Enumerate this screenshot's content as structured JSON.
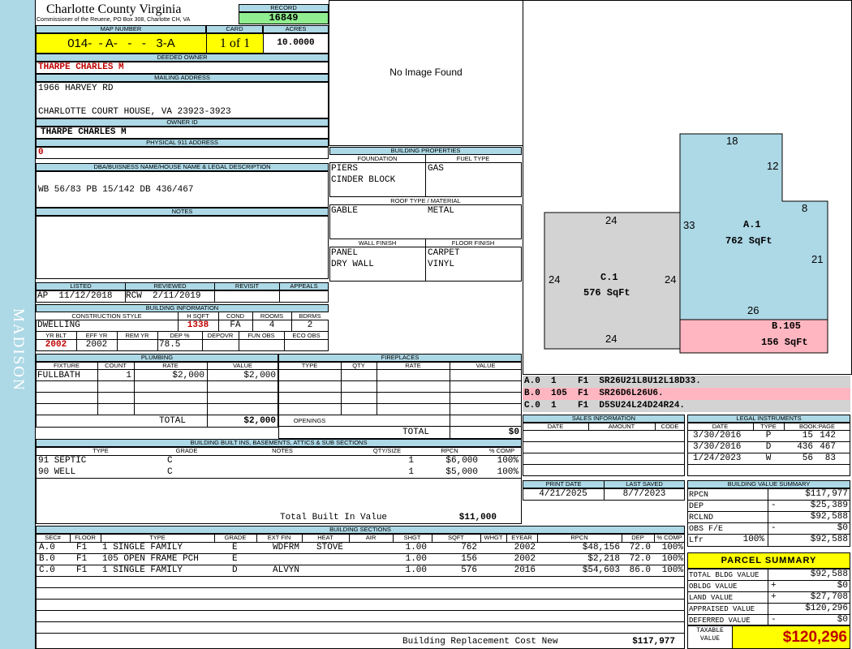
{
  "side_label": "MADISON",
  "county": {
    "title": "Charlotte County Virginia",
    "subtitle": "Commissioner of the Reuene, PO Box 308, Charlotte CH, VA"
  },
  "record": {
    "label": "RECORD",
    "value": "16849"
  },
  "map": {
    "label": "MAP NUMBER",
    "value": "014-  - A-   -   -   3-A"
  },
  "card": {
    "label": "CARD",
    "value": "1 of 1"
  },
  "acres": {
    "label": "ACRES",
    "value": "10.0000"
  },
  "owner": {
    "deeded_label": "DEEDED OWNER",
    "deeded": "THARPE CHARLES M",
    "mailing_label": "MAILING ADDRESS",
    "addr1": "1966 HARVEY RD",
    "addr2": "CHARLOTTE COURT HOUSE, VA 23923-3923",
    "id_label": "OWNER ID",
    "id_name": "THARPE CHARLES M",
    "p911_label": "PHYSICAL 911 ADDRESS",
    "p911": "0"
  },
  "dba": {
    "label": "DBA/BUISNESS NAME/HOUSE NAME & LEGAL DESCRIPTION",
    "value": "WB 56/83 PB 15/142 DB 436/467"
  },
  "notes": {
    "label": "NOTES"
  },
  "image": {
    "text": "No Image Found"
  },
  "building_props": {
    "label": "BUILDING PROPERTIES",
    "foundation_label": "FOUNDATION",
    "foundation": [
      "PIERS",
      "CINDER BLOCK"
    ],
    "fuel_label": "FUEL TYPE",
    "fuel": "GAS",
    "roof_label": "ROOF TYPE / MATERIAL",
    "roof_type": "GABLE",
    "roof_mat": "METAL",
    "wall_label": "WALL FINISH",
    "wall": [
      "PANEL",
      "DRY WALL"
    ],
    "floor_label": "FLOOR FINISH",
    "floor": [
      "CARPET",
      "VINYL"
    ]
  },
  "listing": {
    "listed_label": "LISTED",
    "listed": "AP  11/12/2018",
    "reviewed_label": "REVIEWED",
    "reviewed": "RCW  2/11/2019",
    "revisit_label": "REVISIT",
    "appeals_label": "APPEALS"
  },
  "building_info": {
    "label": "BUILDING INFORMATION",
    "style_label": "CONSTRUCTION STYLE",
    "style": "DWELLING",
    "hsqft_label": "H SQFT",
    "hsqft": "1338",
    "cond_label": "COND",
    "cond": "FA",
    "rooms_label": "ROOMS",
    "rooms": "4",
    "bdrms_label": "BDRMS",
    "bdrms": "2",
    "yrblt_label": "YR BLT",
    "yrblt": "2002",
    "effyr_label": "EFF YR",
    "effyr": "2002",
    "remyr_label": "REM YR",
    "dep_label": "DEP %",
    "dep": "78.5",
    "depovr_label": "DEPOVR",
    "funobs_label": "FUN OBS",
    "ecoobs_label": "ECO OBS"
  },
  "plumbing": {
    "label": "PLUMBING",
    "cols": [
      "FIXTURE",
      "COUNT",
      "RATE",
      "VALUE"
    ],
    "row": {
      "fixture": "FULLBATH",
      "count": "1",
      "rate": "$2,000",
      "value": "$2,000"
    },
    "total_label": "TOTAL",
    "total": "$2,000"
  },
  "fireplaces": {
    "label": "FIREPLACES",
    "cols": [
      "TYPE",
      "QTY",
      "RATE",
      "VALUE"
    ],
    "openings_label": "OPENINGS",
    "total_label": "TOTAL",
    "total": "$0"
  },
  "builtins": {
    "label": "BUILDING BUILT INS, BASEMENTS, ATTICS & SUB SECTIONS",
    "cols": [
      "TYPE",
      "GRADE",
      "NOTES",
      "QTY/SIZE",
      "RPCN",
      "% COMP"
    ],
    "rows": [
      {
        "type": "91 SEPTIC",
        "grade": "C",
        "qty": "1",
        "rpcn": "$6,000",
        "comp": "100%"
      },
      {
        "type": "90 WELL",
        "grade": "C",
        "qty": "1",
        "rpcn": "$5,000",
        "comp": "100%"
      }
    ],
    "total_label": "Total Built In Value",
    "total": "$11,000"
  },
  "sections": {
    "label": "BUILDING SECTIONS",
    "cols": [
      "SEC#",
      "FLOOR",
      "TYPE",
      "GRADE",
      "EXT FIN",
      "HEAT",
      "AIR",
      "SHGT",
      "SQFT",
      "WHGT",
      "EYEAR",
      "RPCN",
      "DEP",
      "% COMP"
    ],
    "rows": [
      {
        "sec": "A.0",
        "floor": "F1",
        "type": "1 SINGLE FAMILY",
        "grade": "E",
        "ext": "WDFRM",
        "heat": "STOVE",
        "shgt": "1.00",
        "sqft": "762",
        "eyear": "2002",
        "rpcn": "$48,156",
        "dep": "72.0",
        "comp": "100%"
      },
      {
        "sec": "B.0",
        "floor": "F1",
        "type": "105 OPEN FRAME PCH",
        "grade": "E",
        "ext": "",
        "heat": "",
        "shgt": "1.00",
        "sqft": "156",
        "eyear": "2002",
        "rpcn": "$2,218",
        "dep": "72.0",
        "comp": "100%"
      },
      {
        "sec": "C.0",
        "floor": "F1",
        "type": "1 SINGLE FAMILY",
        "grade": "D",
        "ext": "ALVYN",
        "heat": "",
        "shgt": "1.00",
        "sqft": "576",
        "eyear": "2016",
        "rpcn": "$54,603",
        "dep": "86.0",
        "comp": "100%"
      }
    ],
    "total_label": "Building Replacement Cost New",
    "total": "$117,977"
  },
  "sketch": {
    "a_label": "A.1",
    "a_sqft": "762 SqFt",
    "a_dims": [
      "18",
      "12",
      "8",
      "33",
      "21",
      "26"
    ],
    "b_label": "B.105",
    "b_sqft": "156 SqFt",
    "c_label": "C.1",
    "c_sqft": "576 SqFt",
    "c_dims": [
      "24",
      "24",
      "24",
      "24"
    ],
    "colors": {
      "a": "#add8e6",
      "b": "#ffb6c1",
      "c": "#d3d3d3"
    }
  },
  "vectors": [
    {
      "text": "A.0  1    F1  SR26U21L8U12L18D33.",
      "color": "#d3d3d3"
    },
    {
      "text": "B.0  105  F1  SR26D6L26U6.",
      "color": "#ffb6c1"
    },
    {
      "text": "C.0  1    F1  D5SU24L24D24R24.",
      "color": "#d3d3d3"
    }
  ],
  "sales": {
    "label": "SALES INFORMATION",
    "cols": [
      "DATE",
      "AMOUNT",
      "CODE"
    ]
  },
  "legal": {
    "label": "LEGAL INSTRUMENTS",
    "cols": [
      "DATE",
      "TYPE",
      "BOOK:PAGE"
    ],
    "rows": [
      {
        "date": "3/30/2016",
        "type": "P",
        "book": "15",
        "page": "142"
      },
      {
        "date": "3/30/2016",
        "type": "D",
        "book": "436",
        "page": "467"
      },
      {
        "date": "1/24/2023",
        "type": "W",
        "book": "56",
        "page": "83"
      }
    ]
  },
  "dates": {
    "print_label": "PRINT DATE",
    "print": "4/21/2025",
    "saved_label": "LAST SAVED",
    "saved": "8/7/2023"
  },
  "bvs": {
    "label": "BUILDING VALUE SUMMARY",
    "rows": [
      {
        "k": "RPCN",
        "s": "",
        "v": "$117,977"
      },
      {
        "k": "DEP",
        "s": "-",
        "v": "$25,389"
      },
      {
        "k": "RCLND",
        "s": "",
        "v": "$92,588"
      },
      {
        "k": "OBS F/E",
        "s": "-",
        "v": "$0"
      },
      {
        "k": "Lfr",
        "s": "100%",
        "v": "$92,588"
      }
    ]
  },
  "parcel": {
    "label": "PARCEL SUMMARY",
    "rows": [
      {
        "k": "TOTAL BLDG VALUE",
        "s": "",
        "v": "$92,588"
      },
      {
        "k": "OBLDG VALUE",
        "s": "+",
        "v": "$0"
      },
      {
        "k": "LAND VALUE",
        "s": "+",
        "v": "$27,708"
      },
      {
        "k": "APPRAISED VALUE",
        "s": "",
        "v": "$120,296"
      },
      {
        "k": "DEFERRED VALUE",
        "s": "-",
        "v": "$0"
      }
    ],
    "taxable_label1": "TAXABLE",
    "taxable_label2": "VALUE",
    "taxable": "$120,296"
  }
}
